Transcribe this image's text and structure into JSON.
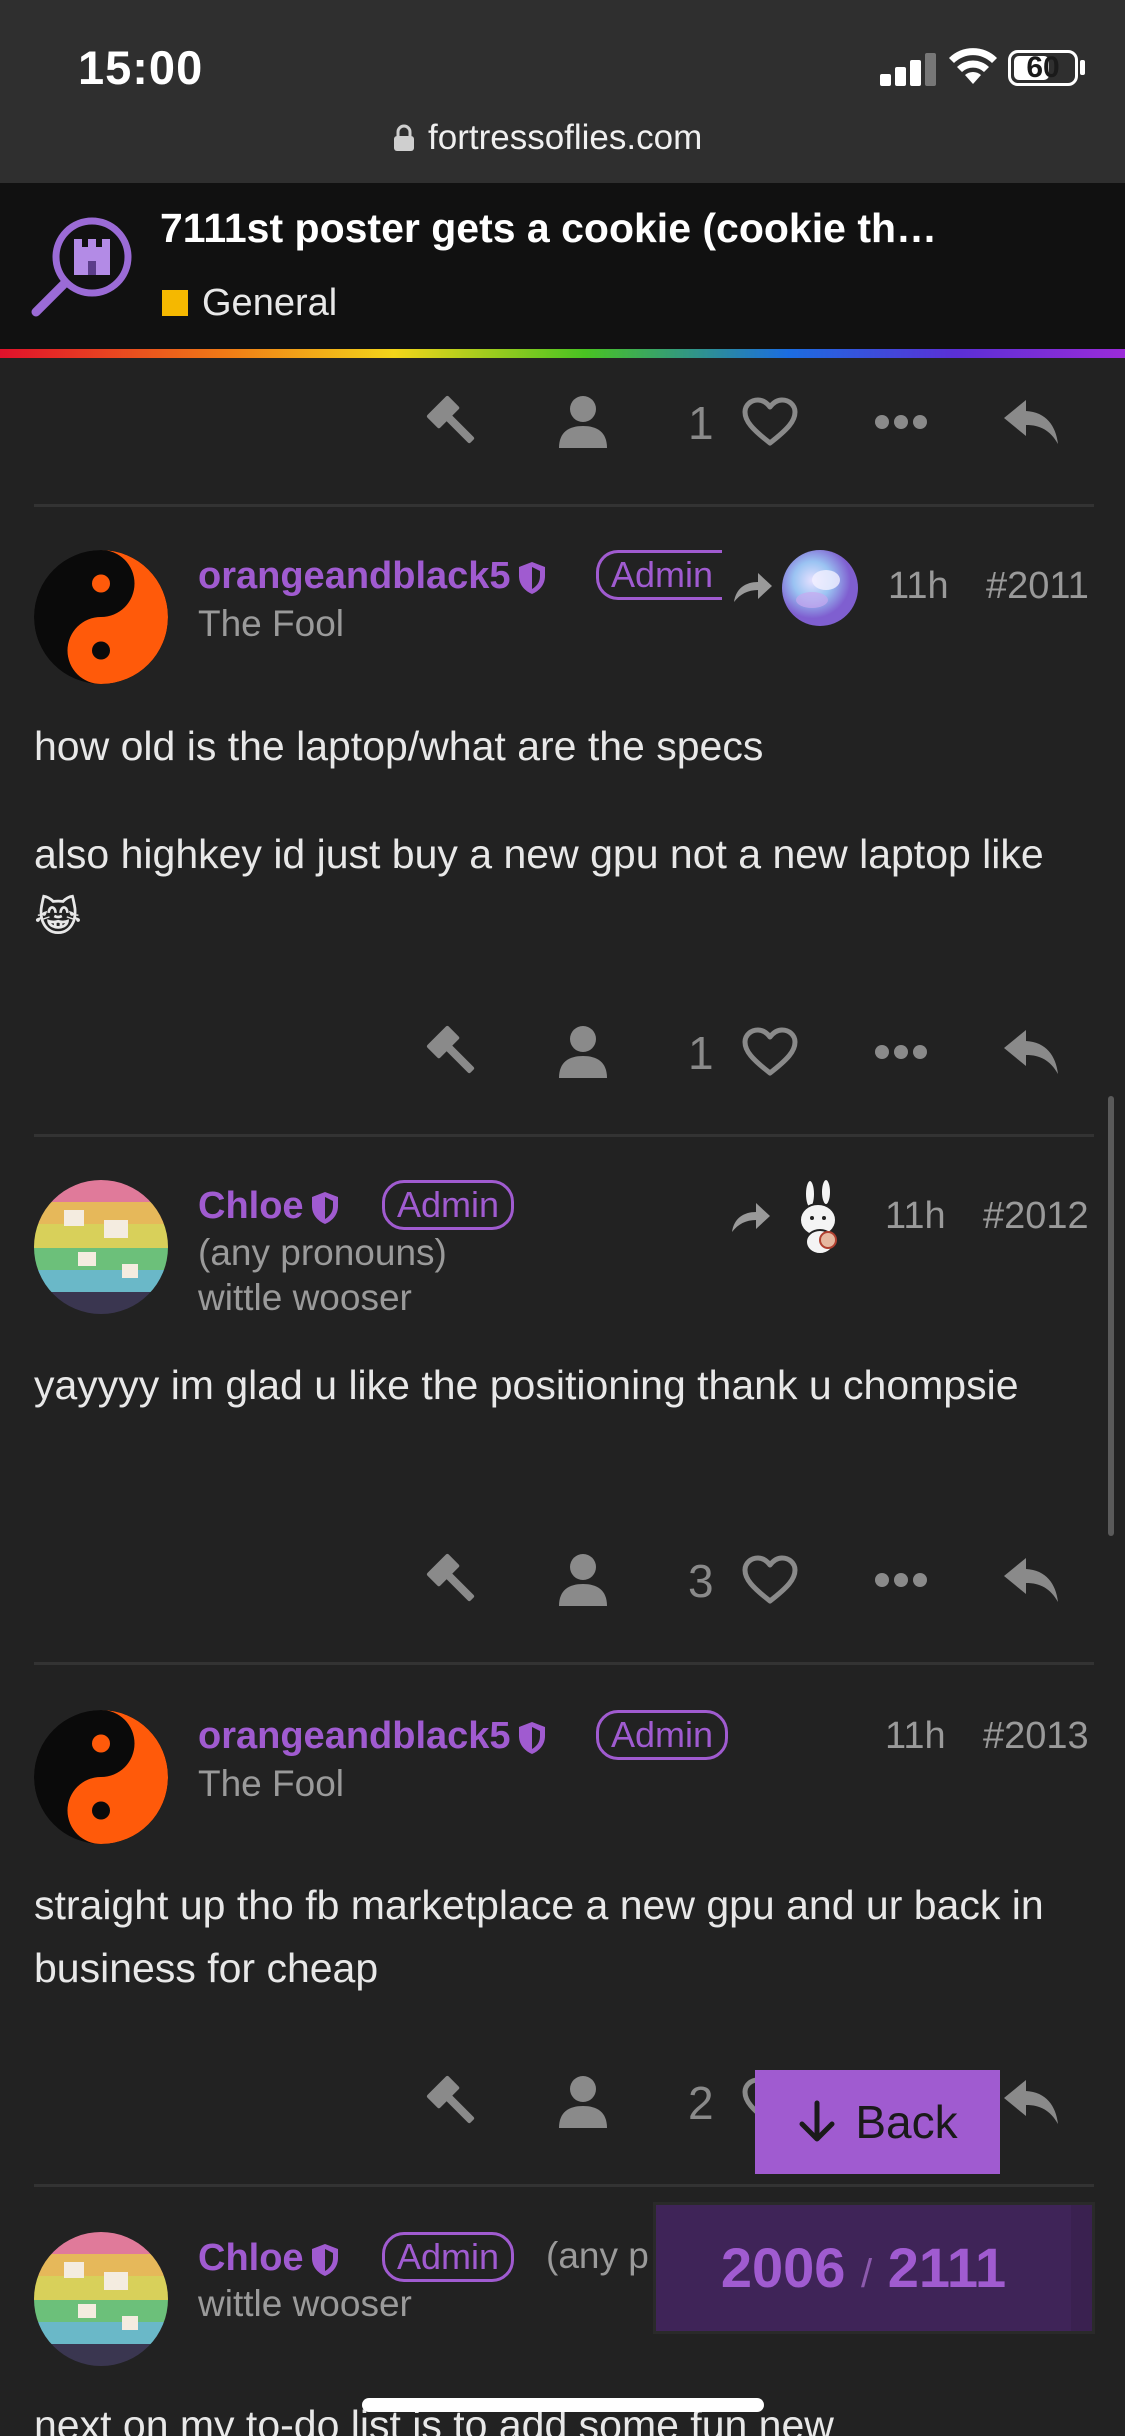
{
  "status_bar": {
    "time": "15:00",
    "battery": "60",
    "battery_level": 0.6
  },
  "browser": {
    "url": "fortressoflies.com"
  },
  "topic": {
    "title": "7111st poster gets a cookie (cookie th…",
    "category": "General",
    "category_color": "#f5b800"
  },
  "accent_color": "#a05bd0",
  "top_actions": {
    "like_count": "1"
  },
  "posts": [
    {
      "username": "orangeandblack5",
      "badge": "Admin",
      "user_title": "The Fool",
      "time": "11h",
      "number": "#2011",
      "has_reply_to": true,
      "paragraphs": [
        "how old is the laptop/what are the specs",
        "also highkey id just buy a new gpu not a new laptop like 😹"
      ],
      "like_count": "1"
    },
    {
      "username": "Chloe",
      "badge": "Admin",
      "pronouns": "(any pronouns)",
      "user_title": "wittle wooser",
      "time": "11h",
      "number": "#2012",
      "has_reply_to": true,
      "paragraphs": [
        "yayyyy im glad u like the positioning thank u chompsie"
      ],
      "like_count": "3"
    },
    {
      "username": "orangeandblack5",
      "badge": "Admin",
      "user_title": "The Fool",
      "time": "11h",
      "number": "#2013",
      "paragraphs": [
        "straight up tho fb marketplace a new gpu and ur back in business for cheap"
      ],
      "like_count": "2"
    },
    {
      "username": "Chloe",
      "badge": "Admin",
      "pronouns": "(any p",
      "user_title": "wittle wooser",
      "paragraphs": [
        "next on my to-do list is to add some fun new"
      ]
    }
  ],
  "back_button": {
    "label": "Back"
  },
  "progress": {
    "current": "2006",
    "separator": "/",
    "total": "2111"
  },
  "icons": [
    "lock-icon",
    "admin-hammer-icon",
    "user-icon",
    "heart-icon",
    "more-icon",
    "reply-icon",
    "share-arrow-icon",
    "shield-icon",
    "arrow-down-icon"
  ]
}
